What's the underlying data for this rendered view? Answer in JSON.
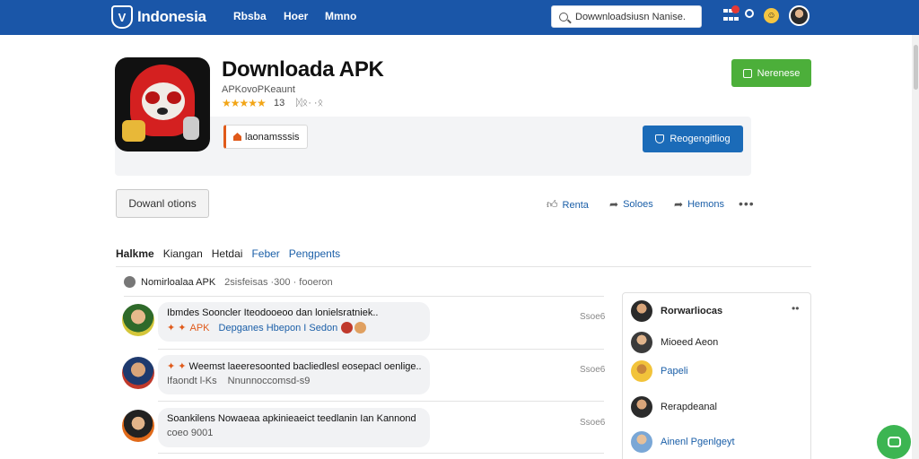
{
  "header": {
    "logo_text": "Indonesia",
    "nav": [
      "Rbsba",
      "Hoer",
      "Mmno"
    ],
    "search_value": "Dowwnloadsiusn Nanise."
  },
  "app": {
    "title": "Downloada APK",
    "subtitle": "APKovoPKeaunt",
    "stars": "★★★★★",
    "rating_count": "13",
    "rating_extra": "ᛞᛟ· ·ᛟ",
    "tag_label": "laonamsssis",
    "primary_button": "Nerenese",
    "secondary_button": "Reogengitliog"
  },
  "actions": {
    "download_options": "Dowanl otions",
    "like": "Renta",
    "share": "Soloes",
    "report": "Hemons",
    "more": "•••"
  },
  "tabs": [
    "Halkme",
    "Kiangan",
    "Hetdai",
    "Feber",
    "Pengpents"
  ],
  "comments_header": {
    "title": "Nomirloalaa APK",
    "meta": "2sisfeisas ·300 · fooeron"
  },
  "comments": [
    {
      "line1": "Ibmdes Sooncler Iteodooeoo dan lonielsratniek..",
      "line2_a": "APK",
      "line2_b": "Depganes Hbepon I Sedon",
      "time": "Ssoe6"
    },
    {
      "line1": "Weemst laeeresoonted bacliedlesl eosepacl oenlige..",
      "line2_a": "Ifaondt l-Ks",
      "line2_b": "Nnunnoccomsd-s9",
      "time": "Ssoe6"
    },
    {
      "line1": "Soankilens Nowaeaa apkinieaeict teedlanin Ian Kannond",
      "line2_a": "coeo 9001",
      "line2_b": "",
      "time": "Ssoe6"
    }
  ],
  "side_panel": {
    "title": "Rorwarliocas",
    "more": "••",
    "items": [
      "Mioeed Aeon",
      "Papeli",
      "Rerapdeanal",
      "Ainenl Pgenlgeyt"
    ]
  },
  "colors": {
    "header_bg": "#1a56a8",
    "primary_green": "#4caf3a",
    "secondary_blue": "#1b6bb8",
    "link_blue": "#1b5fa8",
    "star_gold": "#f2a516"
  },
  "icons": {
    "logo": "shield-logo-icon",
    "search": "search-icon",
    "apps": "grid-icon",
    "settings": "gear-icon",
    "emoji": "smiley-icon",
    "chat": "chat-icon"
  }
}
